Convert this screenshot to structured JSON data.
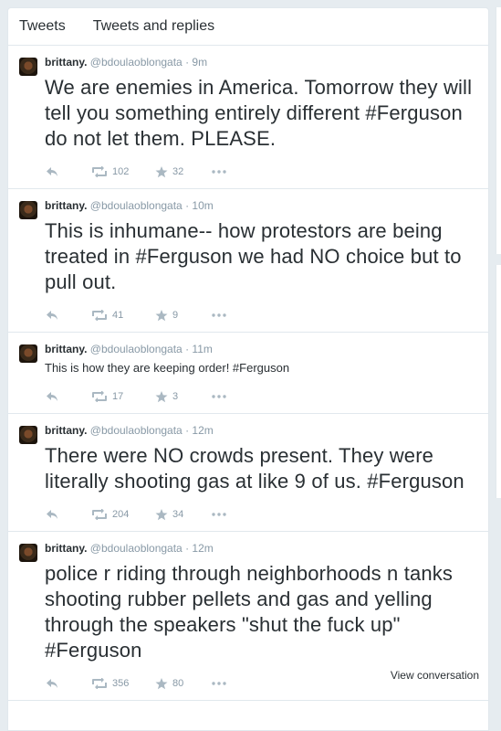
{
  "tabs": [
    "Tweets",
    "Tweets and replies"
  ],
  "tweets": [
    {
      "name": "brittany.",
      "handle": "@bdoulaoblongata",
      "time": "· 9m",
      "text": "We are enemies in America. Tomorrow they will tell you something entirely different #Ferguson do not let them. PLEASE.",
      "retweets": "102",
      "favorites": "32",
      "size": "big"
    },
    {
      "name": "brittany.",
      "handle": "@bdoulaoblongata",
      "time": "· 10m",
      "text": "This is inhumane-- how protestors are being treated in #Ferguson we had NO choice but to pull out.",
      "retweets": "41",
      "favorites": "9",
      "size": "big"
    },
    {
      "name": "brittany.",
      "handle": "@bdoulaoblongata",
      "time": "· 11m",
      "text": "This is how they are keeping order! #Ferguson",
      "retweets": "17",
      "favorites": "3",
      "size": "small"
    },
    {
      "name": "brittany.",
      "handle": "@bdoulaoblongata",
      "time": "· 12m",
      "text": "There were NO crowds present. They were literally shooting gas at like 9 of us. #Ferguson",
      "retweets": "204",
      "favorites": "34",
      "size": "big"
    },
    {
      "name": "brittany.",
      "handle": "@bdoulaoblongata",
      "time": "· 12m",
      "text": "police r riding through neighborhoods n tanks shooting rubber pellets and gas and yelling through the speakers \"shut the fuck up\" #Ferguson",
      "retweets": "356",
      "favorites": "80",
      "size": "big",
      "view_conversation": "View conversation"
    }
  ],
  "colors": {
    "icon": "#aab8c2",
    "meta": "#8899a6",
    "text": "#292f33",
    "border": "#e1e8ed"
  }
}
